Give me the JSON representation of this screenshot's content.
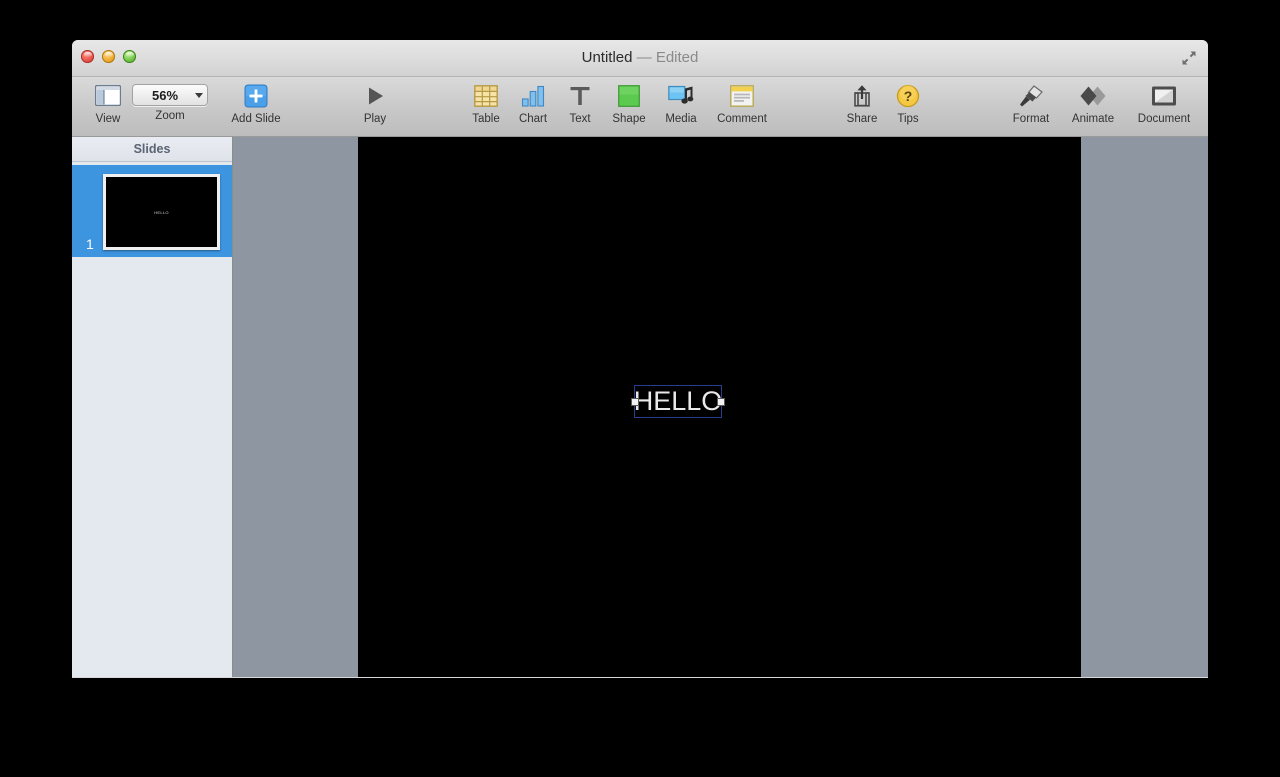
{
  "window": {
    "title_document": "Untitled",
    "title_state": "— Edited",
    "traffic_lights": {
      "close_label": "close-window",
      "minimize_label": "minimize-window",
      "maximize_label": "maximize-window"
    },
    "fullscreen_icon": "fullscreen-expand-icon"
  },
  "toolbar": {
    "view": {
      "label": "View",
      "icon": "view-panel-icon"
    },
    "zoom": {
      "label": "Zoom",
      "value": "56%",
      "icon": "chevron-down-icon"
    },
    "add_slide": {
      "label": "Add Slide",
      "icon": "plus-square-icon"
    },
    "play": {
      "label": "Play",
      "icon": "play-triangle-icon"
    },
    "table": {
      "label": "Table",
      "icon": "table-grid-icon"
    },
    "chart": {
      "label": "Chart",
      "icon": "bar-chart-icon"
    },
    "text": {
      "label": "Text",
      "icon": "text-t-icon"
    },
    "shape": {
      "label": "Shape",
      "icon": "green-square-icon"
    },
    "media": {
      "label": "Media",
      "icon": "media-photo-music-icon"
    },
    "comment": {
      "label": "Comment",
      "icon": "comment-note-icon"
    },
    "share": {
      "label": "Share",
      "icon": "share-upload-icon"
    },
    "tips": {
      "label": "Tips",
      "icon": "question-mark-circle-icon"
    },
    "format": {
      "label": "Format",
      "icon": "paintbrush-icon"
    },
    "animate": {
      "label": "Animate",
      "icon": "diamonds-icon"
    },
    "document": {
      "label": "Document",
      "icon": "document-frame-icon"
    }
  },
  "navigator": {
    "header": "Slides",
    "slides": [
      {
        "number": "1",
        "thumbnail_text": "HELLO",
        "selected": true
      }
    ]
  },
  "canvas": {
    "slide_text": "HELLO",
    "selection_handles": [
      "left-resize-handle",
      "right-resize-handle"
    ]
  },
  "colors": {
    "selection_blue": "#3d95e0",
    "slide_background": "#000000",
    "canvas_backdrop": "#8d96a1",
    "selection_border": "#2b3d8f",
    "navigator_background": "#e4e8ef"
  }
}
